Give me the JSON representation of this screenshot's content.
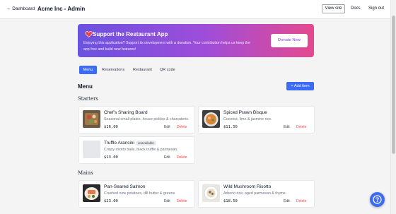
{
  "header": {
    "back_label": "← Dashboard",
    "title": "Acme Inc - Admin",
    "view_site": "View site",
    "docs": "Docs",
    "sign_out": "Sign out"
  },
  "banner": {
    "title": "Support the Restaurant App",
    "text": "Enjoying this application? Support its development with a donation. Your contribution helps us keep the app free and build new features!",
    "button": "Donate Now",
    "icon": "heart-icon"
  },
  "tabs": [
    "Menu",
    "Reservations",
    "Restaurant",
    "QR code"
  ],
  "menu": {
    "title": "Menu",
    "add_label": "+ Add item",
    "categories": [
      {
        "name": "Starters",
        "items": [
          {
            "name": "Chef's Sharing Board",
            "desc": "Seasonal small plates, house pickles & charcuterie.",
            "price": "$16.00",
            "badge": "",
            "image": "board"
          },
          {
            "name": "Spiced Prawn Bisque",
            "desc": "Coconut, lime & jasmine rice.",
            "price": "$11.50",
            "badge": "",
            "image": "bisque"
          },
          {
            "name": "Truffle Arancini",
            "desc": "Crispy risotto balls, black truffle & parmesan.",
            "price": "$13.00",
            "badge": "unavailable",
            "image": "none"
          }
        ]
      },
      {
        "name": "Mains",
        "items": [
          {
            "name": "Pan-Seared Salmon",
            "desc": "Crushed new potatoes, dill butter & greens.",
            "price": "$23.00",
            "badge": "",
            "image": "salmon"
          },
          {
            "name": "Wild Mushroom Risotto",
            "desc": "Arborio rice, aged parmesan & thyme.",
            "price": "$18.50",
            "badge": "",
            "image": "risotto"
          }
        ]
      }
    ],
    "edit_label": "Edit",
    "delete_label": "Delete"
  },
  "help": {
    "icon": "question-icon"
  }
}
